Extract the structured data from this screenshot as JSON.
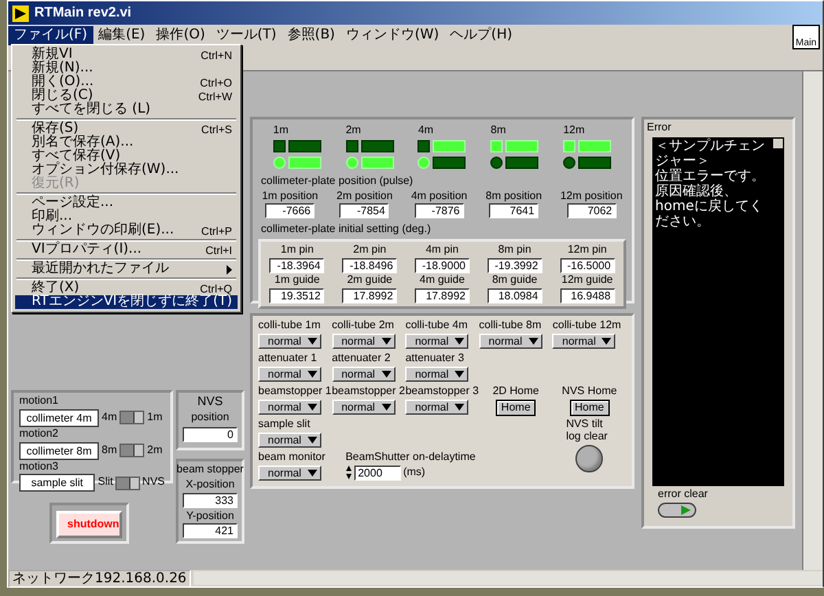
{
  "window": {
    "title": "RTMain rev2.vi",
    "corner_label": "Main"
  },
  "menu_bar": [
    {
      "label": "ファイル(F)",
      "selected": true
    },
    {
      "label": "編集(E)",
      "selected": false
    },
    {
      "label": "操作(O)",
      "selected": false
    },
    {
      "label": "ツール(T)",
      "selected": false
    },
    {
      "label": "参照(B)",
      "selected": false
    },
    {
      "label": "ウィンドウ(W)",
      "selected": false
    },
    {
      "label": "ヘルプ(H)",
      "selected": false
    }
  ],
  "file_menu": [
    [
      {
        "label": "新規VI",
        "shortcut": "Ctrl+N",
        "disabled": false,
        "selected": false,
        "submenu": false
      },
      {
        "label": "新規(N)...",
        "disabled": false,
        "selected": false,
        "submenu": false
      },
      {
        "label": "開く(O)...",
        "shortcut": "Ctrl+O",
        "disabled": false,
        "selected": false,
        "submenu": false
      },
      {
        "label": "閉じる(C)",
        "shortcut": "Ctrl+W",
        "disabled": false,
        "selected": false,
        "submenu": false
      },
      {
        "label": "すべてを閉じる (L)",
        "disabled": false,
        "selected": false,
        "submenu": false
      }
    ],
    [
      {
        "label": "保存(S)",
        "shortcut": "Ctrl+S",
        "disabled": false,
        "selected": false,
        "submenu": false
      },
      {
        "label": "別名で保存(A)...",
        "disabled": false,
        "selected": false,
        "submenu": false
      },
      {
        "label": "すべて保存(V)",
        "disabled": false,
        "selected": false,
        "submenu": false
      },
      {
        "label": "オプション付保存(W)...",
        "disabled": false,
        "selected": false,
        "submenu": false
      },
      {
        "label": "復元(R)",
        "disabled": true,
        "selected": false,
        "submenu": false
      }
    ],
    [
      {
        "label": "ページ設定...",
        "disabled": false,
        "selected": false,
        "submenu": false
      },
      {
        "label": "印刷...",
        "disabled": false,
        "selected": false,
        "submenu": false
      },
      {
        "label": "ウィンドウの印刷(E)...",
        "shortcut": "Ctrl+P",
        "disabled": false,
        "selected": false,
        "submenu": false
      }
    ],
    [
      {
        "label": "VIプロパティ(I)...",
        "shortcut": "Ctrl+I",
        "disabled": false,
        "selected": false,
        "submenu": false
      }
    ],
    [
      {
        "label": "最近開かれたファイル",
        "disabled": false,
        "selected": false,
        "submenu": true
      }
    ],
    [
      {
        "label": "終了(X)",
        "shortcut": "Ctrl+Q",
        "disabled": false,
        "selected": false,
        "submenu": false
      },
      {
        "label": "RTエンジンVIを閉じずに終了(T)",
        "disabled": false,
        "selected": true,
        "submenu": false
      }
    ]
  ],
  "nvs": {
    "title": "NVS",
    "label": "position",
    "value": "0"
  },
  "beam_stopper": {
    "title": "beam stopper",
    "fields": [
      {
        "label": "X-position",
        "value": "333"
      },
      {
        "label": "Y-position",
        "value": "421"
      }
    ]
  },
  "motions": [
    {
      "name": "motion1",
      "value": "collimeter 4m",
      "left_label": "4m",
      "right_label": "1m",
      "on": false
    },
    {
      "name": "motion2",
      "value": "collimeter 8m",
      "left_label": "8m",
      "right_label": "2m",
      "on": false
    },
    {
      "name": "motion3",
      "value": "sample slit",
      "left_label": "Slit",
      "right_label": "NVS",
      "on": false
    }
  ],
  "shutdown_button": {
    "label": "shutdown"
  },
  "collimeter": {
    "lamps": [
      {
        "label": "1m",
        "top_square": false,
        "top_bar": false,
        "bottom_round": true,
        "bottom_bar": true
      },
      {
        "label": "2m",
        "top_square": false,
        "top_bar": false,
        "bottom_round": true,
        "bottom_bar": true
      },
      {
        "label": "4m",
        "top_square": false,
        "top_bar": true,
        "bottom_round": true,
        "bottom_bar": false
      },
      {
        "label": "8m",
        "top_square": true,
        "top_bar": true,
        "bottom_round": false,
        "bottom_bar": false
      },
      {
        "label": "12m",
        "top_square": true,
        "top_bar": true,
        "bottom_round": false,
        "bottom_bar": false
      }
    ],
    "position_title": "collimeter-plate position (pulse)",
    "positions": [
      {
        "label": "1m position",
        "value": "-7666"
      },
      {
        "label": "2m position",
        "value": "-7854"
      },
      {
        "label": "4m position",
        "value": "-7876"
      },
      {
        "label": "8m position",
        "value": "7641"
      },
      {
        "label": "12m position",
        "value": "7062"
      }
    ],
    "initial_title": "collimeter-plate initial setting (deg.)",
    "pins": [
      {
        "label": "1m pin",
        "value": "-18.3964"
      },
      {
        "label": "2m pin",
        "value": "-18.8496"
      },
      {
        "label": "4m pin",
        "value": "-18.9000"
      },
      {
        "label": "8m pin",
        "value": "-19.3992"
      },
      {
        "label": "12m pin",
        "value": "-16.5000"
      }
    ],
    "guides": [
      {
        "label": "1m guide",
        "value": "19.3512"
      },
      {
        "label": "2m guide",
        "value": "17.8992"
      },
      {
        "label": "4m guide",
        "value": "17.8992"
      },
      {
        "label": "8m guide",
        "value": "18.0984"
      },
      {
        "label": "12m guide",
        "value": "16.9488"
      }
    ]
  },
  "controls": {
    "rows": [
      [
        {
          "label": "colli-tube 1m",
          "value": "normal"
        },
        {
          "label": "colli-tube 2m",
          "value": "normal"
        },
        {
          "label": "colli-tube 4m",
          "value": "normal"
        },
        {
          "label": "colli-tube 8m",
          "value": "normal"
        },
        {
          "label": "colli-tube 12m",
          "value": "normal"
        }
      ],
      [
        {
          "label": "attenuater 1",
          "value": "normal"
        },
        {
          "label": "attenuater 2",
          "value": "normal"
        },
        {
          "label": "attenuater 3",
          "value": "normal"
        }
      ],
      [
        {
          "label": "beamstopper 1",
          "value": "normal"
        },
        {
          "label": "beamstopper 2",
          "value": "normal"
        },
        {
          "label": "beamstopper 3",
          "value": "normal"
        }
      ],
      [
        {
          "label": "sample slit",
          "value": "normal"
        }
      ],
      [
        {
          "label": "beam monitor",
          "value": "normal"
        }
      ]
    ],
    "delay": {
      "label": "BeamShutter on-delaytime",
      "value": "2000",
      "unit": "(ms)"
    },
    "homes": [
      {
        "label": "2D Home",
        "button": "Home"
      },
      {
        "label": "NVS Home",
        "button": "Home"
      }
    ],
    "tilt_clear": {
      "label": "NVS tilt log clear"
    }
  },
  "error": {
    "title": "Error",
    "lines": [
      "＜サンプルチェンジャー＞",
      "位置エラーです。原因確認後、homeに戻してください。"
    ],
    "clear_label": "error clear"
  },
  "status_bar": {
    "text": "ネットワーク192.168.0.26"
  }
}
